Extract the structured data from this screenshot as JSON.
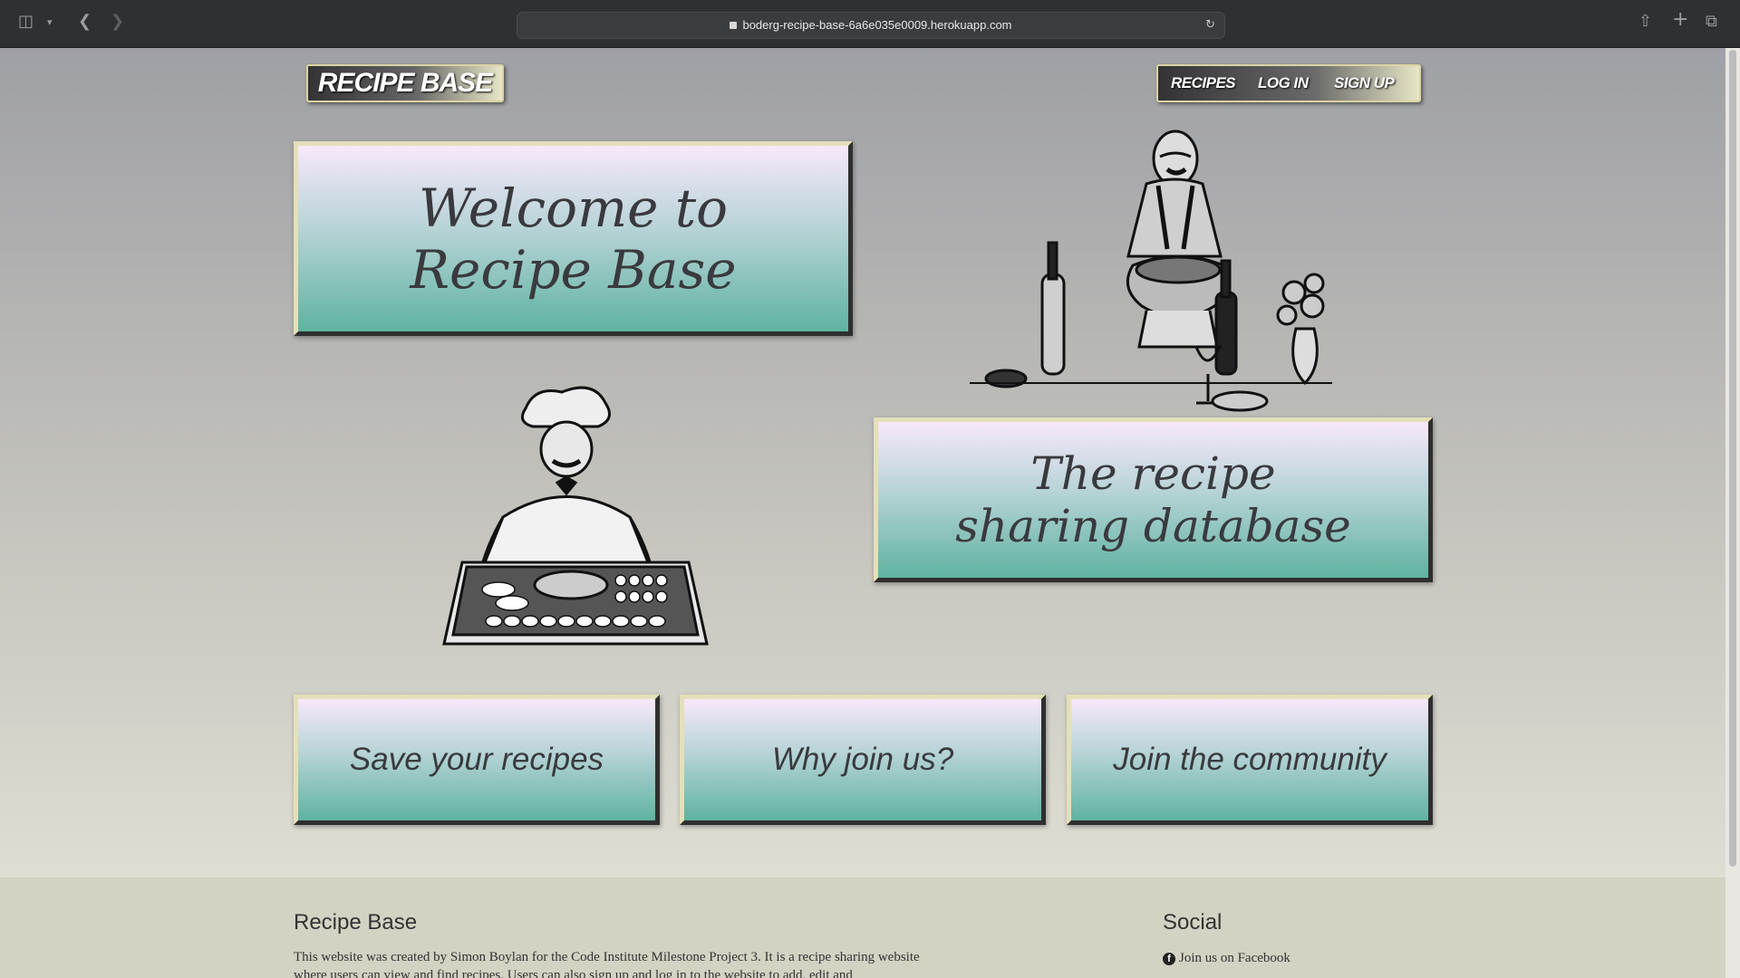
{
  "browser": {
    "url": "boderg-recipe-base-6a6e035e0009.herokuapp.com"
  },
  "header": {
    "logo": "RECIPE BASE",
    "nav": [
      {
        "label": "RECIPES"
      },
      {
        "label": "LOG IN"
      },
      {
        "label": "SIGN UP"
      }
    ]
  },
  "hero": {
    "welcome_line1": "Welcome to",
    "welcome_line2": "Recipe Base",
    "tagline_line1": "The recipe",
    "tagline_line2": "sharing database"
  },
  "features": [
    {
      "label": "Save your recipes"
    },
    {
      "label": "Why join us?"
    },
    {
      "label": "Join the community"
    }
  ],
  "footer": {
    "about_heading": "Recipe Base",
    "about_text": "This website was created by Simon Boylan for the Code Institute Milestone Project 3. It is a recipe sharing website where users can view and find recipes. Users can also sign up and log in to the website to add, edit and",
    "social_heading": "Social",
    "social_links": [
      {
        "label": "Join us on Facebook"
      }
    ]
  }
}
